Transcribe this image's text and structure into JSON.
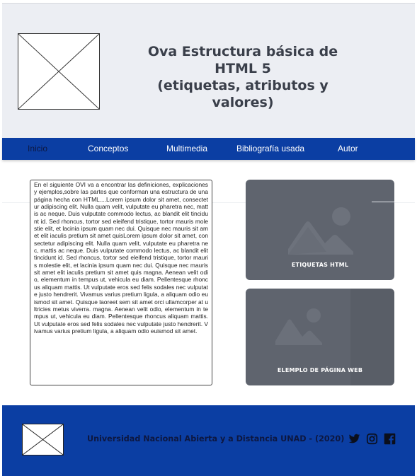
{
  "header": {
    "title_line1": "Ova Estructura básica de HTML 5",
    "title_line2": "(etiquetas, atributos y",
    "title_line3": "valores)",
    "logo_icon": "image-placeholder-icon"
  },
  "nav": {
    "items": [
      {
        "label": "Inicio",
        "active": true
      },
      {
        "label": "Conceptos"
      },
      {
        "label": "Multimedia"
      },
      {
        "label": "Bibliografía usada"
      },
      {
        "label": "Autor"
      }
    ],
    "colors": {
      "bar": "#0b3ea3",
      "text": "#ffffff",
      "active_text": "#0d1740"
    }
  },
  "content": {
    "intro_text": "En el siguiente  OVI va a encontrar las definiciones, explicaciones y ejemplos,sobre las partes que conforman una estructura de una página hecha con HTML....Lorem ipsum dolor sit amet, consectetur adipiscing elit. Nulla quam velit, vulputate eu pharetra nec, mattis ac neque. Duis vulputate commodo lectus, ac blandit elit tincidunt id. Sed rhoncus, tortor sed eleifend tristique, tortor mauris molestie elit, et lacinia ipsum quam nec dui. Quisque nec mauris sit amet elit iaculis pretium sit amet quisLorem ipsum dolor sit amet, consectetur adipiscing elit. Nulla quam velit, vulputate eu pharetra nec, mattis ac neque. Duis vulputate commodo lectus, ac blandit elit tincidunt id. Sed rhoncus, tortor sed eleifend tristique, tortor mauris molestie elit, et lacinia ipsum quam nec dui. Quisque nec mauris sit amet elit iaculis pretium sit amet quis magna. Aenean velit odio, elementum in tempus ut, vehicula eu diam. Pellentesque rhoncus aliquam mattis. Ut vulputate eros sed felis sodales nec vulputate justo hendrerit. Vivamus varius pretium ligula, a aliquam odio euismod sit amet. Quisque laoreet sem sit amet orci ullamcorper at ultricies metus viverra. magna. Aenean velit odio, elementum in tempus ut, vehicula eu diam. Pellentesque rhoncus aliquam mattis. Ut vulputate eros sed felis sodales nec vulputate justo hendrerit. Vivamus varius pretium ligula, a aliquam odio euismod sit amet."
  },
  "cards": [
    {
      "caption": "ETIQUETAS HTML",
      "icon": "image-icon"
    },
    {
      "caption": "ELEMPLO DE PÁGINA WEB",
      "icon": "image-icon"
    }
  ],
  "footer": {
    "text": "Universidad Nacional Abierta y a Distancia UNAD - (2020)",
    "logo_icon": "image-placeholder-icon",
    "social": [
      "twitter-icon",
      "instagram-icon",
      "facebook-icon"
    ],
    "background": "#0b3ea3"
  }
}
